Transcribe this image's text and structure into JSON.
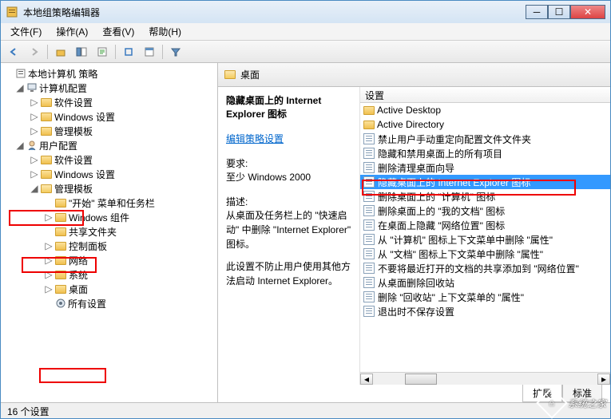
{
  "window": {
    "title": "本地组策略编辑器"
  },
  "menu": {
    "file": "文件(F)",
    "action": "操作(A)",
    "view": "查看(V)",
    "help": "帮助(H)"
  },
  "tree": {
    "root": "本地计算机 策略",
    "computer_config": "计算机配置",
    "cc_software": "软件设置",
    "cc_windows": "Windows 设置",
    "cc_templates": "管理模板",
    "user_config": "用户配置",
    "uc_software": "软件设置",
    "uc_windows": "Windows 设置",
    "uc_templates": "管理模板",
    "start_taskbar": "\"开始\" 菜单和任务栏",
    "win_components": "Windows 组件",
    "shared_folders": "共享文件夹",
    "control_panel": "控制面板",
    "network": "网络",
    "system": "系统",
    "desktop": "桌面",
    "all_settings": "所有设置"
  },
  "header": {
    "title": "桌面"
  },
  "detail": {
    "title": "隐藏桌面上的 Internet Explorer 图标",
    "edit_link": "编辑策略设置",
    "req_label": "要求:",
    "req_value": "至少 Windows 2000",
    "desc_label": "描述:",
    "desc_line1": "从桌面及任务栏上的 \"快速启动\" 中删除 \"Internet Explorer\" 图标。",
    "desc_line2": "此设置不防止用户使用其他方法启动 Internet Explorer。"
  },
  "list": {
    "header": "设置",
    "items": [
      {
        "label": "Active Desktop",
        "type": "folder"
      },
      {
        "label": "Active Directory",
        "type": "folder"
      },
      {
        "label": "禁止用户手动重定向配置文件文件夹",
        "type": "setting"
      },
      {
        "label": "隐藏和禁用桌面上的所有项目",
        "type": "setting"
      },
      {
        "label": "删除清理桌面向导",
        "type": "setting"
      },
      {
        "label": "隐藏桌面上的 Internet Explorer 图标",
        "type": "setting",
        "selected": true
      },
      {
        "label": "删除桌面上的 \"计算机\" 图标",
        "type": "setting"
      },
      {
        "label": "删除桌面上的 \"我的文档\" 图标",
        "type": "setting"
      },
      {
        "label": "在桌面上隐藏 \"网络位置\" 图标",
        "type": "setting"
      },
      {
        "label": "从 \"计算机\" 图标上下文菜单中删除 \"属性\"",
        "type": "setting"
      },
      {
        "label": "从 \"文档\" 图标上下文菜单中删除 \"属性\"",
        "type": "setting"
      },
      {
        "label": "不要将最近打开的文档的共享添加到 \"网络位置\"",
        "type": "setting"
      },
      {
        "label": "从桌面删除回收站",
        "type": "setting"
      },
      {
        "label": "删除 \"回收站\" 上下文菜单的 \"属性\"",
        "type": "setting"
      },
      {
        "label": "退出时不保存设置",
        "type": "setting"
      }
    ]
  },
  "tabs": {
    "extended": "扩展",
    "standard": "标准"
  },
  "status": {
    "count": "16 个设置"
  },
  "watermark": "系统之家"
}
